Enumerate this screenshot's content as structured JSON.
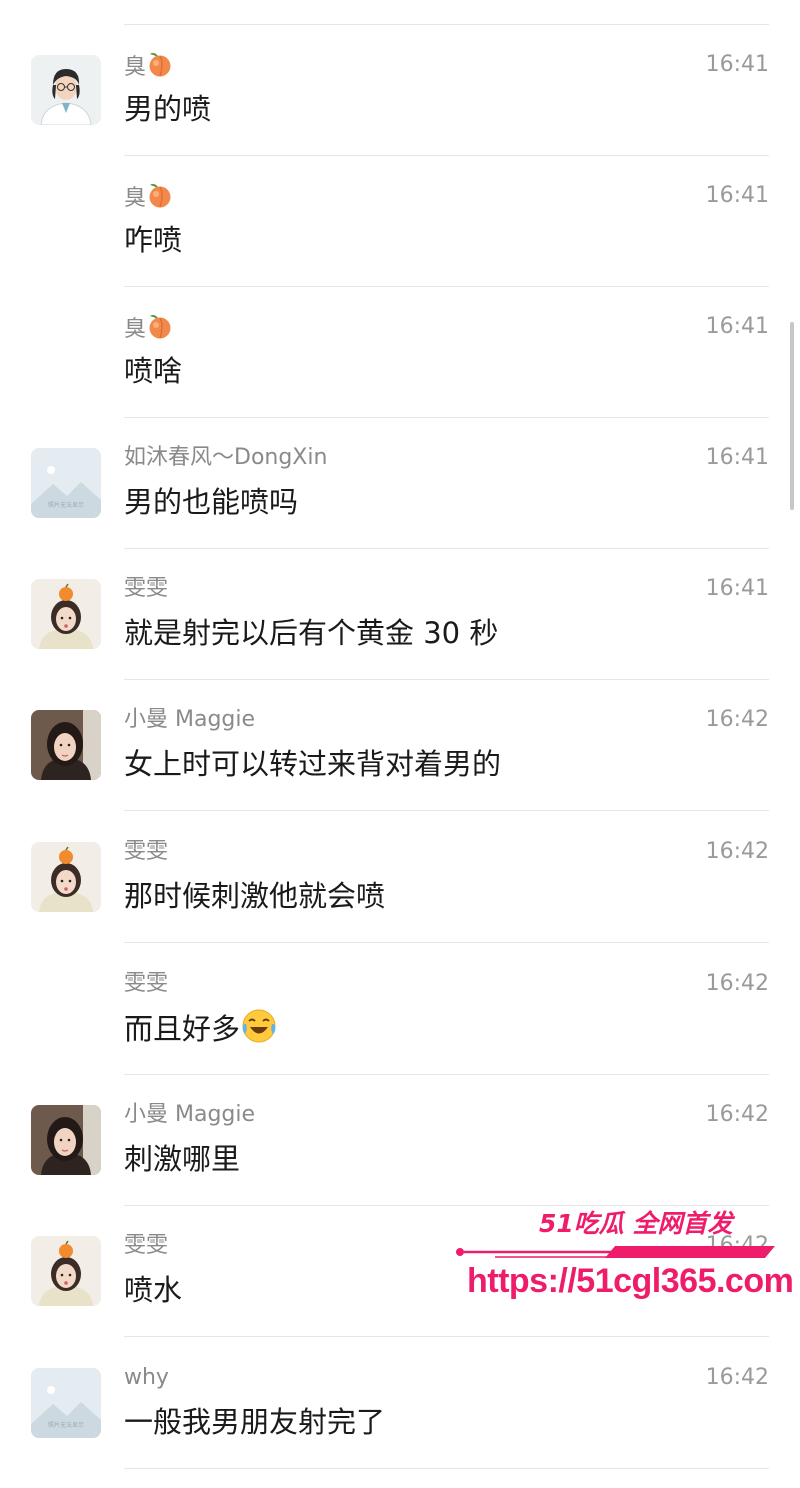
{
  "messages": [
    {
      "sender": "臭",
      "sender_emoji": "peach-emoji",
      "time": "16:41",
      "text": "男的喷",
      "avatar": "avatar-cartoon-doctor"
    },
    {
      "sender": "臭",
      "sender_emoji": "peach-emoji",
      "time": "16:41",
      "text": "咋喷",
      "avatar": ""
    },
    {
      "sender": "臭",
      "sender_emoji": "peach-emoji",
      "time": "16:41",
      "text": "喷啥",
      "avatar": ""
    },
    {
      "sender": "如沐春风～DongXin",
      "time": "16:41",
      "text": "男的也能喷吗",
      "avatar": "avatar-placeholder",
      "avatar_caption": "照片无法显示"
    },
    {
      "sender": "雯雯",
      "time": "16:41",
      "text": "就是射完以后有个黄金 30 秒",
      "avatar": "avatar-girl-orange"
    },
    {
      "sender": "小曼 Maggie",
      "time": "16:42",
      "text": "女上时可以转过来背对着男的",
      "avatar": "avatar-woman-portrait"
    },
    {
      "sender": "雯雯",
      "time": "16:42",
      "text": "那时候刺激他就会喷",
      "avatar": "avatar-girl-orange"
    },
    {
      "sender": "雯雯",
      "time": "16:42",
      "text": "而且好多",
      "text_emoji": "laughing-tears-emoji",
      "avatar": ""
    },
    {
      "sender": "小曼 Maggie",
      "time": "16:42",
      "text": "刺激哪里",
      "avatar": "avatar-woman-portrait"
    },
    {
      "sender": "雯雯",
      "time": "16:42",
      "text": "喷水",
      "avatar": "avatar-girl-orange"
    },
    {
      "sender": "why",
      "time": "16:42",
      "text": "一般我男朋友射完了",
      "avatar": "avatar-placeholder",
      "avatar_caption": "照片无法显示"
    }
  ],
  "watermark": {
    "brand": "51吃瓜 全网首发",
    "url": "https://51cgl365.com"
  },
  "colors": {
    "watermark": "#ee1c6a",
    "divider": "#e6e6e6",
    "sender": "#8a8a8a",
    "text": "#1a1a1a"
  }
}
